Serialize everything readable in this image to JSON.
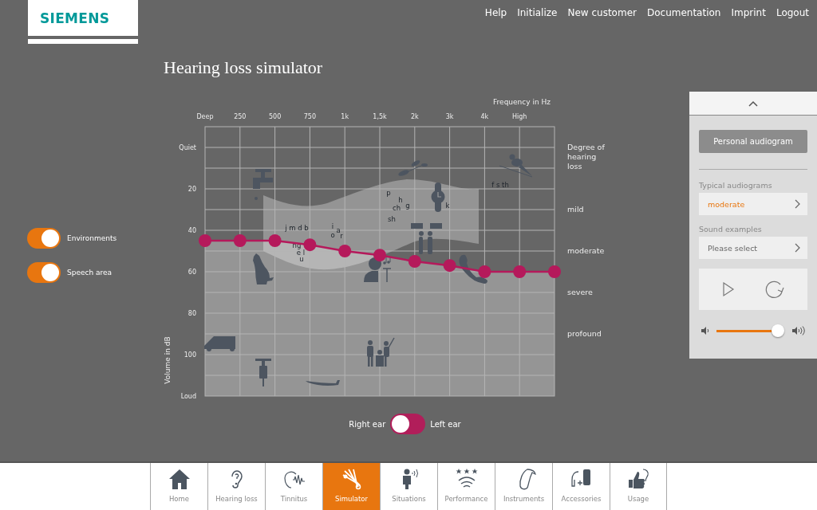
{
  "header": {
    "logo": "SIEMENS",
    "links": [
      "Help",
      "Initialize",
      "New customer",
      "Documentation",
      "Imprint",
      "Logout"
    ]
  },
  "title": "Hearing loss simulator",
  "toggles": [
    {
      "label": "Environments",
      "on": true
    },
    {
      "label": "Speech area",
      "on": true
    }
  ],
  "chart": {
    "chart_data": {
      "type": "line",
      "xlabel": "Frequency in Hz",
      "ylabel": "Volume in dB",
      "categories": [
        "Deep",
        "250",
        "500",
        "750",
        "1k",
        "1,5k",
        "2k",
        "3k",
        "4k",
        "High"
      ],
      "ylim": [
        120,
        -10
      ],
      "yticks": [
        {
          "value": 0,
          "label": "Quiet"
        },
        {
          "value": 20,
          "label": "20"
        },
        {
          "value": 40,
          "label": "40"
        },
        {
          "value": 60,
          "label": "60"
        },
        {
          "value": 80,
          "label": "80"
        },
        {
          "value": 100,
          "label": "100"
        },
        {
          "value": 120,
          "label": "Loud"
        }
      ],
      "grid": true,
      "series": [
        {
          "color": "#b5195b",
          "marker": "circle",
          "values": [
            45,
            45,
            45,
            47,
            50,
            52,
            55,
            57,
            60,
            60
          ]
        }
      ]
    },
    "degree_of_loss": {
      "title": "Degree of hearing loss",
      "levels": [
        "mild",
        "moderate",
        "severe",
        "profound"
      ]
    },
    "speech_sounds": [
      "j m d b",
      "ng",
      "e l",
      "u",
      "i",
      "o",
      "a",
      "r",
      "p",
      "h",
      "ch",
      "g",
      "sh",
      "k",
      "f s th"
    ]
  },
  "ear_switch": {
    "labels": [
      "Right ear",
      "Left ear"
    ],
    "on": false
  },
  "panel": {
    "personal_button": "Personal audiogram",
    "typical": {
      "label": "Typical audiograms",
      "value": "moderate"
    },
    "sound": {
      "label": "Sound examples",
      "placeholder": "Please select"
    },
    "volume": {
      "level": 0.9
    }
  },
  "nav": [
    {
      "label": "Home",
      "selected": false
    },
    {
      "label": "Hearing loss",
      "selected": false
    },
    {
      "label": "Tinnitus",
      "selected": false
    },
    {
      "label": "Simulator",
      "selected": true
    },
    {
      "label": "Situations",
      "selected": false
    },
    {
      "label": "Performance",
      "selected": false
    },
    {
      "label": "Instruments",
      "selected": false
    },
    {
      "label": "Accessories",
      "selected": false
    },
    {
      "label": "Usage",
      "selected": false
    }
  ]
}
